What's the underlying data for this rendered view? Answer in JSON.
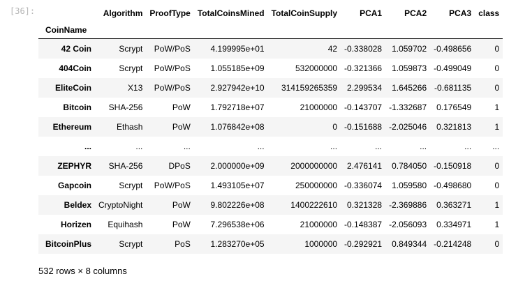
{
  "prompt": "[36]:",
  "table": {
    "index_name": "CoinName",
    "columns": [
      "Algorithm",
      "ProofType",
      "TotalCoinsMined",
      "TotalCoinSupply",
      "PCA1",
      "PCA2",
      "PCA3",
      "class"
    ],
    "rows": [
      {
        "index": "42 Coin",
        "cells": [
          "Scrypt",
          "PoW/PoS",
          "4.199995e+01",
          "42",
          "-0.338028",
          "1.059702",
          "-0.498656",
          "0"
        ]
      },
      {
        "index": "404Coin",
        "cells": [
          "Scrypt",
          "PoW/PoS",
          "1.055185e+09",
          "532000000",
          "-0.321366",
          "1.059873",
          "-0.499049",
          "0"
        ]
      },
      {
        "index": "EliteCoin",
        "cells": [
          "X13",
          "PoW/PoS",
          "2.927942e+10",
          "314159265359",
          "2.299534",
          "1.645266",
          "-0.681135",
          "0"
        ]
      },
      {
        "index": "Bitcoin",
        "cells": [
          "SHA-256",
          "PoW",
          "1.792718e+07",
          "21000000",
          "-0.143707",
          "-1.332687",
          "0.176549",
          "1"
        ]
      },
      {
        "index": "Ethereum",
        "cells": [
          "Ethash",
          "PoW",
          "1.076842e+08",
          "0",
          "-0.151688",
          "-2.025046",
          "0.321813",
          "1"
        ]
      },
      {
        "index": "...",
        "cells": [
          "...",
          "...",
          "...",
          "...",
          "...",
          "...",
          "...",
          "..."
        ]
      },
      {
        "index": "ZEPHYR",
        "cells": [
          "SHA-256",
          "DPoS",
          "2.000000e+09",
          "2000000000",
          "2.476141",
          "0.784050",
          "-0.150918",
          "0"
        ]
      },
      {
        "index": "Gapcoin",
        "cells": [
          "Scrypt",
          "PoW/PoS",
          "1.493105e+07",
          "250000000",
          "-0.336074",
          "1.059580",
          "-0.498680",
          "0"
        ]
      },
      {
        "index": "Beldex",
        "cells": [
          "CryptoNight",
          "PoW",
          "9.802226e+08",
          "1400222610",
          "0.321328",
          "-2.369886",
          "0.363271",
          "1"
        ]
      },
      {
        "index": "Horizen",
        "cells": [
          "Equihash",
          "PoW",
          "7.296538e+06",
          "21000000",
          "-0.148387",
          "-2.056093",
          "0.334971",
          "1"
        ]
      },
      {
        "index": "BitcoinPlus",
        "cells": [
          "Scrypt",
          "PoS",
          "1.283270e+05",
          "1000000",
          "-0.292921",
          "0.849344",
          "-0.214248",
          "0"
        ]
      }
    ]
  },
  "summary": "532 rows × 8 columns"
}
